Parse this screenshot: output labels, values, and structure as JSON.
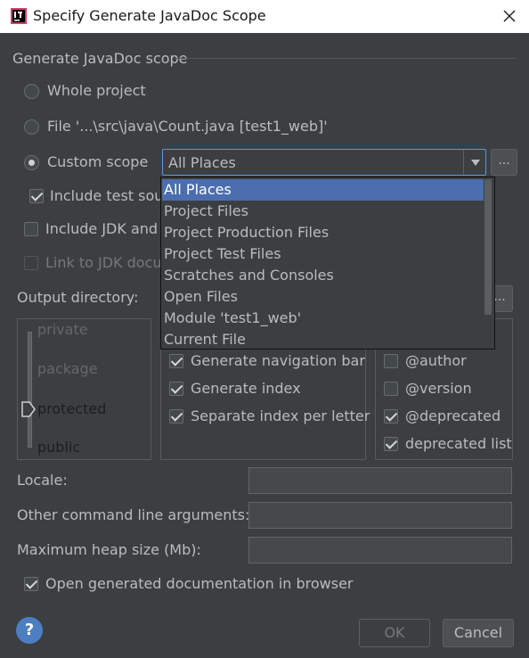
{
  "window": {
    "title": "Specify Generate JavaDoc Scope"
  },
  "scope_group": {
    "title": "Generate JavaDoc scope",
    "whole_project": "Whole project",
    "file": "File '...\\src\\java\\Count.java [test1_web]'",
    "custom_scope": "Custom scope",
    "combo_value": "All Places",
    "include_test": "Include test sour",
    "include_jdk": "Include JDK and",
    "link_jdk": "Link to JDK docu",
    "browse_label": "..."
  },
  "dropdown": {
    "items": [
      "All Places",
      "Project Files",
      "Project Production Files",
      "Project Test Files",
      "Scratches and Consoles",
      "Open Files",
      "Module 'test1_web'",
      "Current File"
    ],
    "selected": "All Places"
  },
  "output_directory": {
    "label": "Output directory:",
    "browse_label": "..."
  },
  "visibility_levels": {
    "items": [
      "private",
      "package",
      "protected",
      "public"
    ],
    "selected": "protected"
  },
  "options": {
    "nav_bar": "Generate navigation bar",
    "index": "Generate index",
    "separate_index": "Separate index per letter"
  },
  "tags": {
    "author": "@author",
    "version": "@version",
    "deprecated": "@deprecated",
    "deprecated_list": "deprecated list"
  },
  "fields": {
    "locale": "Locale:",
    "other_args": "Other command line arguments:",
    "max_heap": "Maximum heap size (Mb):"
  },
  "open_in_browser": "Open generated documentation in browser",
  "buttons": {
    "help": "?",
    "ok": "OK",
    "cancel": "Cancel"
  },
  "colors": {
    "accent": "#4b6eaf",
    "background": "#3c3f41",
    "help": "#4c7ec1"
  }
}
